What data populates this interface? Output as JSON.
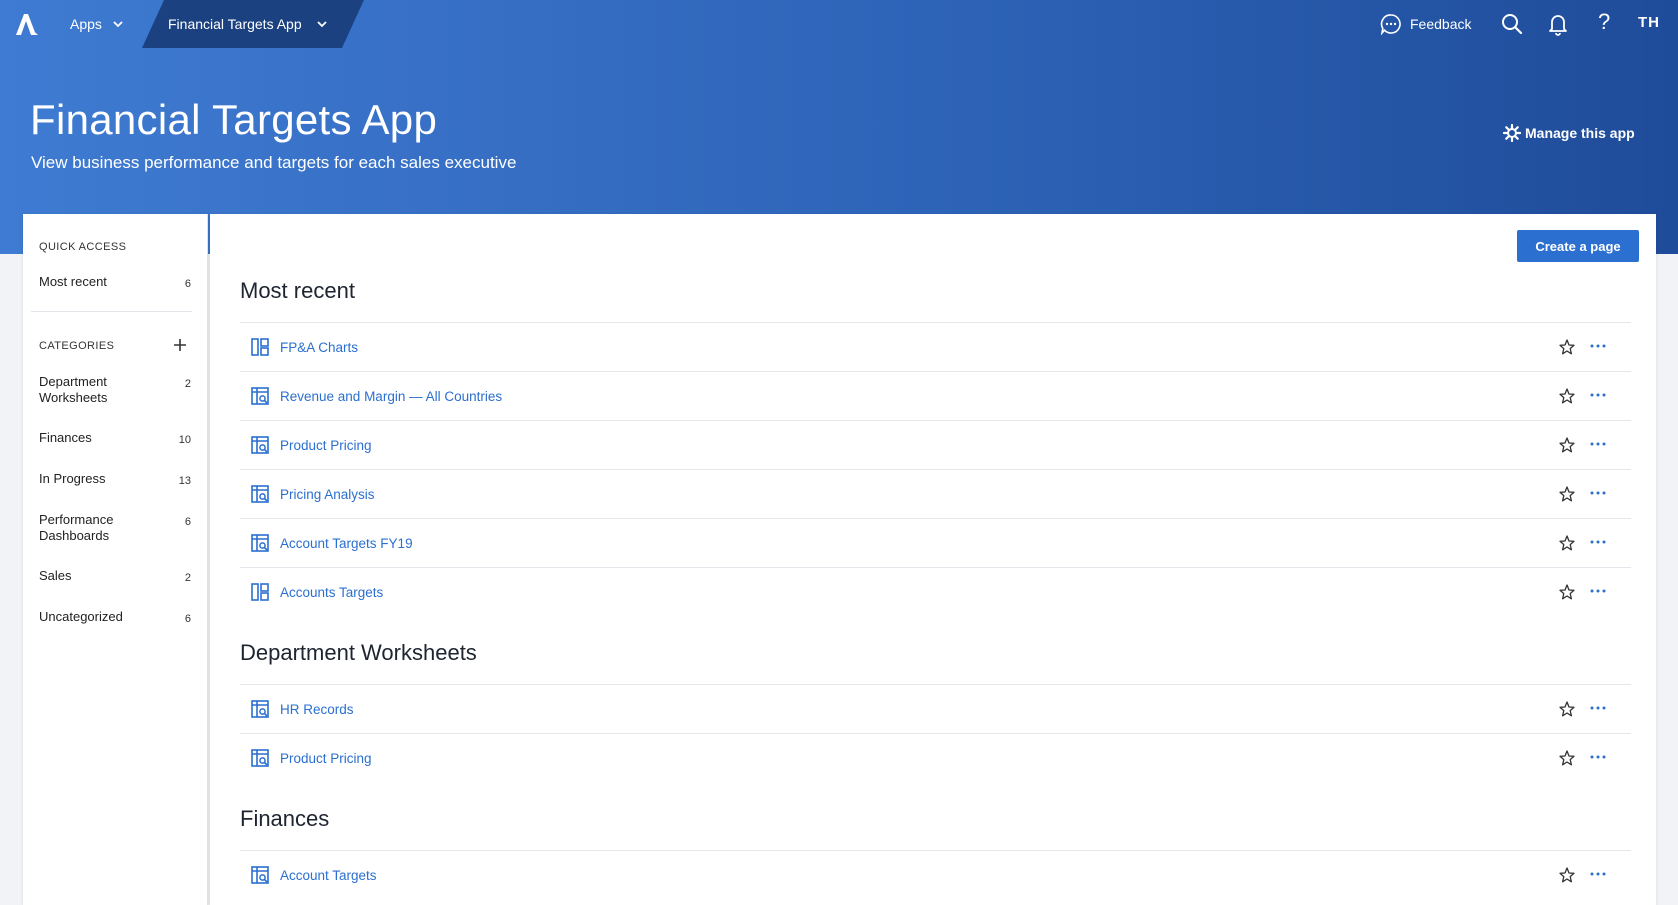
{
  "colors": {
    "banner": "#2e64b8",
    "breadcrumb": "#1b4180",
    "accent": "#2b6fd0",
    "link": "#2b6fd0"
  },
  "topbar": {
    "apps_label": "Apps",
    "breadcrumb_label": "Financial Targets App",
    "feedback_label": "Feedback",
    "help_label": "?",
    "user_initials": "TH"
  },
  "header": {
    "title": "Financial Targets App",
    "subtitle": "View business performance and targets for each sales executive",
    "manage_label": "Manage this app"
  },
  "sidebar": {
    "quick_access_heading": "QUICK ACCESS",
    "quick_access": [
      {
        "label": "Most recent",
        "count": "6"
      }
    ],
    "categories_heading": "CATEGORIES",
    "categories": [
      {
        "label": "Department Worksheets",
        "count": "2"
      },
      {
        "label": "Finances",
        "count": "10"
      },
      {
        "label": "In Progress",
        "count": "13"
      },
      {
        "label": "Performance Dashboards",
        "count": "6"
      },
      {
        "label": "Sales",
        "count": "2"
      },
      {
        "label": "Uncategorized",
        "count": "6"
      }
    ]
  },
  "main": {
    "create_label": "Create a page",
    "sections": [
      {
        "title": "Most recent",
        "items": [
          {
            "label": "FP&A Charts",
            "icon": "dashboard-icon"
          },
          {
            "label": "Revenue and Margin — All Countries",
            "icon": "worksheet-icon"
          },
          {
            "label": "Product Pricing",
            "icon": "worksheet-icon"
          },
          {
            "label": "Pricing Analysis",
            "icon": "worksheet-icon"
          },
          {
            "label": "Account Targets FY19",
            "icon": "worksheet-icon"
          },
          {
            "label": "Accounts Targets",
            "icon": "dashboard-icon"
          }
        ]
      },
      {
        "title": "Department Worksheets",
        "items": [
          {
            "label": "HR Records",
            "icon": "worksheet-icon"
          },
          {
            "label": "Product Pricing",
            "icon": "worksheet-icon"
          }
        ]
      },
      {
        "title": "Finances",
        "items": [
          {
            "label": "Account Targets",
            "icon": "worksheet-icon"
          }
        ]
      }
    ]
  }
}
